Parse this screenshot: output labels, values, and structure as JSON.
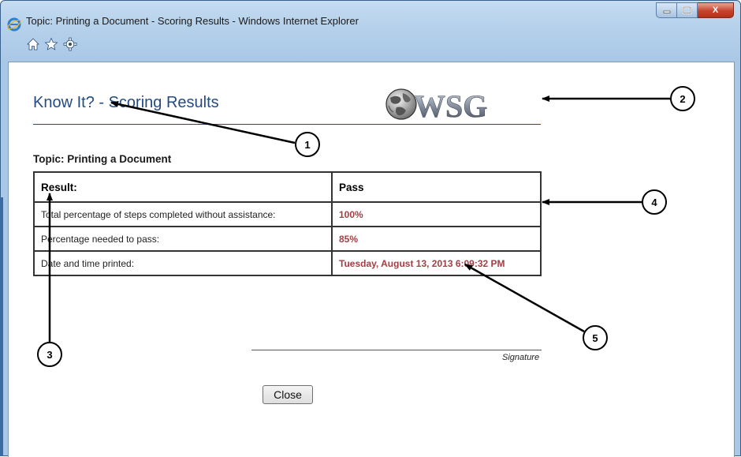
{
  "window": {
    "title": "Topic: Printing a Document - Scoring Results - Windows Internet Explorer",
    "controls": {
      "minimize": "",
      "maximize": "",
      "close": "X"
    },
    "toolbar_icons": [
      "home-icon",
      "star-icon",
      "gear-icon"
    ]
  },
  "page": {
    "title": "Know It? - Scoring Results",
    "logo_text": "WSG",
    "topic_label": "Topic: Printing a Document",
    "results": {
      "header": {
        "label": "Result:",
        "value": "Pass"
      },
      "rows": [
        {
          "label": "Total percentage of steps completed without assistance:",
          "value": "100%"
        },
        {
          "label": "Percentage needed to pass:",
          "value": "85%"
        },
        {
          "label": "Date and time printed:",
          "value": "Tuesday, August 13, 2013 6:09:32 PM"
        }
      ]
    },
    "signature_label": "Signature",
    "close_button": "Close"
  },
  "callouts": [
    "1",
    "2",
    "3",
    "4",
    "5"
  ],
  "colors": {
    "title_blue": "#244b82",
    "value_red": "#a33f44",
    "frame_blue": "#a9c7e6"
  }
}
